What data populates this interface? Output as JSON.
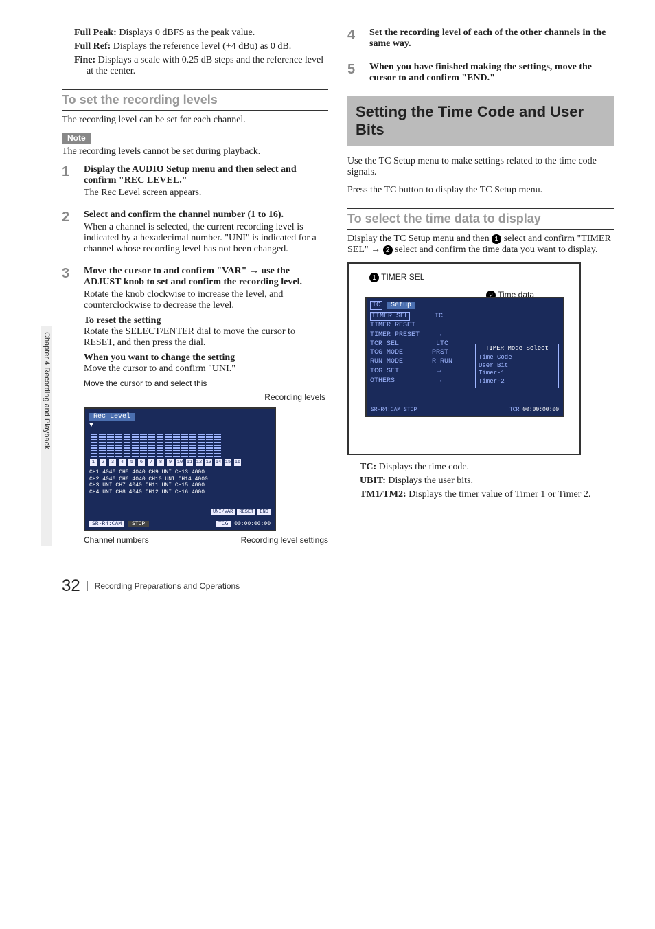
{
  "sidetab": "Chapter 4  Recording and Playback",
  "left": {
    "defs": [
      {
        "term": "Full Peak: ",
        "text": "Displays 0 dBFS as the peak value."
      },
      {
        "term": "Full Ref: ",
        "text": "Displays the reference level (+4 dBu) as 0 dB."
      },
      {
        "term": "Fine: ",
        "text": "Displays a scale with 0.25 dB steps and the reference level at the center."
      }
    ],
    "heading_rec_levels": "To set the recording levels",
    "rec_intro": "The recording level can be set for each channel.",
    "note_label": "Note",
    "note_text": "The recording levels cannot be set during playback.",
    "steps": [
      {
        "num": "1",
        "head": "Display the AUDIO Setup menu and then select and confirm \"REC LEVEL.\"",
        "body": "The Rec Level screen appears."
      },
      {
        "num": "2",
        "head": "Select and confirm the channel number (1 to 16).",
        "body": "When a channel is selected, the current recording level is indicated by a hexadecimal number. \"UNI\" is indicated for a channel whose recording level has not been changed."
      },
      {
        "num": "3",
        "head": "Move the cursor to and confirm \"VAR\" → use the ADJUST knob to set and confirm the recording level.",
        "body": "Rotate the knob clockwise to increase the level, and counterclockwise to decrease the level.",
        "sub1_head": "To reset the setting",
        "sub1_body": "Rotate the SELECT/ENTER dial to move the cursor to RESET, and then press the dial.",
        "sub2_head": "When you want to change the setting",
        "sub2_body": "Move the cursor to and confirm \"UNI.\""
      }
    ],
    "fig_annot_top": "Move the cursor to and select this",
    "fig_annot_right": "Recording levels",
    "fig_annot_bl": "Channel numbers",
    "fig_annot_br": "Recording level settings",
    "fig_rec": {
      "title": "Rec Level",
      "rows": [
        "CH1 4040  CH5 4040  CH9  UNI   CH13 4000",
        "CH2 4040  CH6 4040  CH10 UNI   CH14 4000",
        "CH3 UNI   CH7 4040  CH11 UNI   CH15 4000",
        "CH4 UNI   CH8 4040  CH12 UNI   CH16 4000"
      ],
      "btns": [
        "UNI/VAR",
        "RESET",
        "END"
      ],
      "status_l": "SR-R4:CAM",
      "status_c": "STOP",
      "status_rl": "TCG",
      "status_rt": "00:00:00:00"
    }
  },
  "right": {
    "steps": [
      {
        "num": "4",
        "head": "Set the recording level of each of the other channels in the same way."
      },
      {
        "num": "5",
        "head": "When you have finished making the settings, move the cursor to and confirm \"END.\""
      }
    ],
    "section_heading": "Setting the Time Code and User Bits",
    "section_intro1": "Use the TC Setup menu to make settings related to the time code signals.",
    "section_intro2": "Press the TC button to display the TC Setup menu.",
    "heading_select_td": "To select the time data to display",
    "select_intro_a": "Display the TC Setup menu and then ",
    "select_intro_b": " select and confirm \"TIMER SEL\" → ",
    "select_intro_c": " select and confirm the time data you want to display.",
    "callout_1": "1",
    "callout_1_label": "TIMER SEL",
    "callout_2": "2",
    "callout_2_label": "Time data",
    "fig_tc": {
      "tab_l": "TC",
      "tab_r": "Setup",
      "rows": [
        [
          "TIMER SEL",
          "TC"
        ],
        [
          "TIMER RESET",
          ""
        ],
        [
          "TIMER PRESET",
          "→"
        ],
        [
          "TCR SEL",
          "LTC"
        ],
        [
          "TCG MODE",
          "PRST"
        ],
        [
          "RUN MODE",
          "R RUN"
        ],
        [
          "TCG SET",
          "→"
        ],
        [
          "OTHERS",
          "→"
        ]
      ],
      "pop_title": "TIMER Mode Select",
      "pop_items": [
        "Time Code",
        "User Bit",
        "Timer-1",
        "Timer-2"
      ],
      "status_l": "SR-R4:CAM",
      "status_c": "STOP",
      "status_rl": "TCR",
      "status_rt": "00:00:00:00"
    },
    "defs2": [
      {
        "term": "TC: ",
        "text": "Displays the time code."
      },
      {
        "term": "UBIT: ",
        "text": "Displays the user bits."
      },
      {
        "term": "TM1/TM2: ",
        "text": "Displays the timer value of Timer 1 or Timer 2."
      }
    ]
  },
  "footer": {
    "page": "32",
    "title": "Recording Preparations and Operations"
  }
}
